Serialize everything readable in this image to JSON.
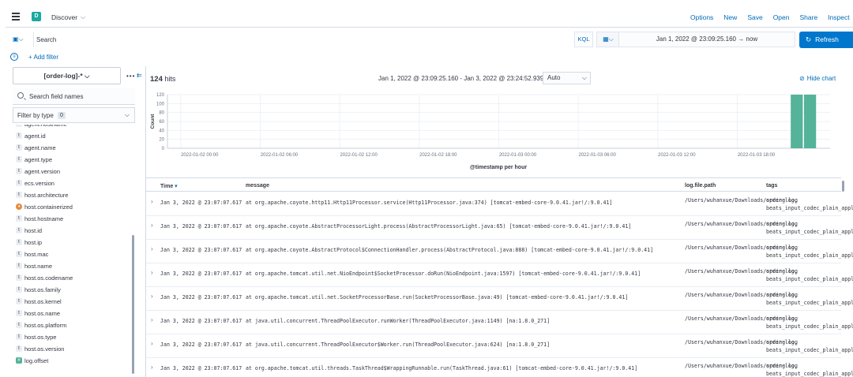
{
  "header": {
    "space_initial": "D",
    "app_title": "Discover",
    "actions": [
      "Options",
      "New",
      "Save",
      "Open",
      "Share",
      "Inspect"
    ]
  },
  "query": {
    "placeholder": "Search",
    "language": "KQL",
    "date_range": "Jan 1, 2022 @ 23:09:25.160  →  now",
    "refresh_label": "Refresh"
  },
  "filters": {
    "add_label": "+ Add filter"
  },
  "sidebar": {
    "index_pattern": "[order-log]-*",
    "search_placeholder": "Search field names",
    "filter_by_type_label": "Filter by type",
    "filter_count": "0",
    "fields": [
      {
        "type": "t",
        "kind": "string",
        "name": "agent.hostname"
      },
      {
        "type": "t",
        "kind": "string",
        "name": "agent.id"
      },
      {
        "type": "t",
        "kind": "string",
        "name": "agent.name"
      },
      {
        "type": "t",
        "kind": "string",
        "name": "agent.type"
      },
      {
        "type": "t",
        "kind": "string",
        "name": "agent.version"
      },
      {
        "type": "t",
        "kind": "string",
        "name": "ecs.version"
      },
      {
        "type": "t",
        "kind": "string",
        "name": "host.architecture"
      },
      {
        "type": "◕",
        "kind": "bool",
        "name": "host.containerized"
      },
      {
        "type": "t",
        "kind": "string",
        "name": "host.hostname"
      },
      {
        "type": "t",
        "kind": "string",
        "name": "host.id"
      },
      {
        "type": "t",
        "kind": "string",
        "name": "host.ip"
      },
      {
        "type": "t",
        "kind": "string",
        "name": "host.mac"
      },
      {
        "type": "t",
        "kind": "string",
        "name": "host.name"
      },
      {
        "type": "t",
        "kind": "string",
        "name": "host.os.codename"
      },
      {
        "type": "t",
        "kind": "string",
        "name": "host.os.family"
      },
      {
        "type": "t",
        "kind": "string",
        "name": "host.os.kernel"
      },
      {
        "type": "t",
        "kind": "string",
        "name": "host.os.name"
      },
      {
        "type": "t",
        "kind": "string",
        "name": "host.os.platform"
      },
      {
        "type": "t",
        "kind": "string",
        "name": "host.os.type"
      },
      {
        "type": "t",
        "kind": "string",
        "name": "host.os.version"
      },
      {
        "type": "#",
        "kind": "number",
        "name": "log.offset"
      }
    ]
  },
  "results": {
    "hits_count": "124",
    "hits_label": "hits",
    "time_range": "Jan 1, 2022 @ 23:09:25.160 - Jan 3, 2022 @ 23:24:52.939",
    "interval": "Auto",
    "hide_chart_label": "Hide chart"
  },
  "chart_data": {
    "type": "bar",
    "ylabel": "Count",
    "xlabel": "@timestamp per hour",
    "ylim": [
      0,
      120
    ],
    "yticks": [
      "120",
      "100",
      "80",
      "60",
      "40",
      "20",
      "0"
    ],
    "xticks": [
      "2022-01-02 00:00",
      "2022-01-02 06:00",
      "2022-01-02 12:00",
      "2022-01-02 18:00",
      "2022-01-03 00:00",
      "2022-01-03 06:00",
      "2022-01-03 12:00",
      "2022-01-03 18:00"
    ],
    "x_start_hours": -1,
    "x_end_hours": 49,
    "values": [
      {
        "hour_offset": 46,
        "value": 120
      },
      {
        "hour_offset": 47,
        "value": 120
      }
    ],
    "bar_color": "#54b399",
    "grid": true
  },
  "table": {
    "columns": [
      "Time",
      "message",
      "log.file.path",
      "tags"
    ],
    "rows": [
      {
        "time": "Jan 3, 2022 @ 23:07:07.617",
        "message": "at org.apache.coyote.http11.Http11Processor.service(Http11Processor.java:374) [tomcat-embed-core-9.0.41.jar!/:9.0.41]",
        "path": "/Users/wuhanxue/Downloads/spring.log",
        "tags": "order-log, beats_input_codec_plain_applied"
      },
      {
        "time": "Jan 3, 2022 @ 23:07:07.617",
        "message": "at org.apache.coyote.AbstractProcessorLight.process(AbstractProcessorLight.java:65) [tomcat-embed-core-9.0.41.jar!/:9.0.41]",
        "path": "/Users/wuhanxue/Downloads/spring.log",
        "tags": "order-log, beats_input_codec_plain_applied"
      },
      {
        "time": "Jan 3, 2022 @ 23:07:07.617",
        "message": "at org.apache.coyote.AbstractProtocol$ConnectionHandler.process(AbstractProtocol.java:888) [tomcat-embed-core-9.0.41.jar!/:9.0.41]",
        "path": "/Users/wuhanxue/Downloads/spring.log",
        "tags": "order-log, beats_input_codec_plain_applied"
      },
      {
        "time": "Jan 3, 2022 @ 23:07:07.617",
        "message": "at org.apache.tomcat.util.net.NioEndpoint$SocketProcessor.doRun(NioEndpoint.java:1597) [tomcat-embed-core-9.0.41.jar!/:9.0.41]",
        "path": "/Users/wuhanxue/Downloads/spring.log",
        "tags": "order-log, beats_input_codec_plain_applied"
      },
      {
        "time": "Jan 3, 2022 @ 23:07:07.617",
        "message": "at org.apache.tomcat.util.net.SocketProcessorBase.run(SocketProcessorBase.java:49) [tomcat-embed-core-9.0.41.jar!/:9.0.41]",
        "path": "/Users/wuhanxue/Downloads/spring.log",
        "tags": "order-log, beats_input_codec_plain_applied"
      },
      {
        "time": "Jan 3, 2022 @ 23:07:07.617",
        "message": "at java.util.concurrent.ThreadPoolExecutor.runWorker(ThreadPoolExecutor.java:1149) [na:1.8.0_271]",
        "path": "/Users/wuhanxue/Downloads/spring.log",
        "tags": "order-log, beats_input_codec_plain_applied"
      },
      {
        "time": "Jan 3, 2022 @ 23:07:07.617",
        "message": "at java.util.concurrent.ThreadPoolExecutor$Worker.run(ThreadPoolExecutor.java:624) [na:1.8.0_271]",
        "path": "/Users/wuhanxue/Downloads/spring.log",
        "tags": "order-log, beats_input_codec_plain_applied"
      },
      {
        "time": "Jan 3, 2022 @ 23:07:07.617",
        "message": "at org.apache.tomcat.util.threads.TaskThread$WrappingRunnable.run(TaskThread.java:61) [tomcat-embed-core-9.0.41.jar!/:9.0.41]",
        "path": "/Users/wuhanxue/Downloads/spring.log",
        "tags": "order-log, beats_input_codec_plain_applied"
      }
    ]
  },
  "colors": {
    "link": "#006bb8",
    "primary": "#0077cc",
    "space_badge": "#1ba9a1",
    "border": "#d3dae6"
  }
}
